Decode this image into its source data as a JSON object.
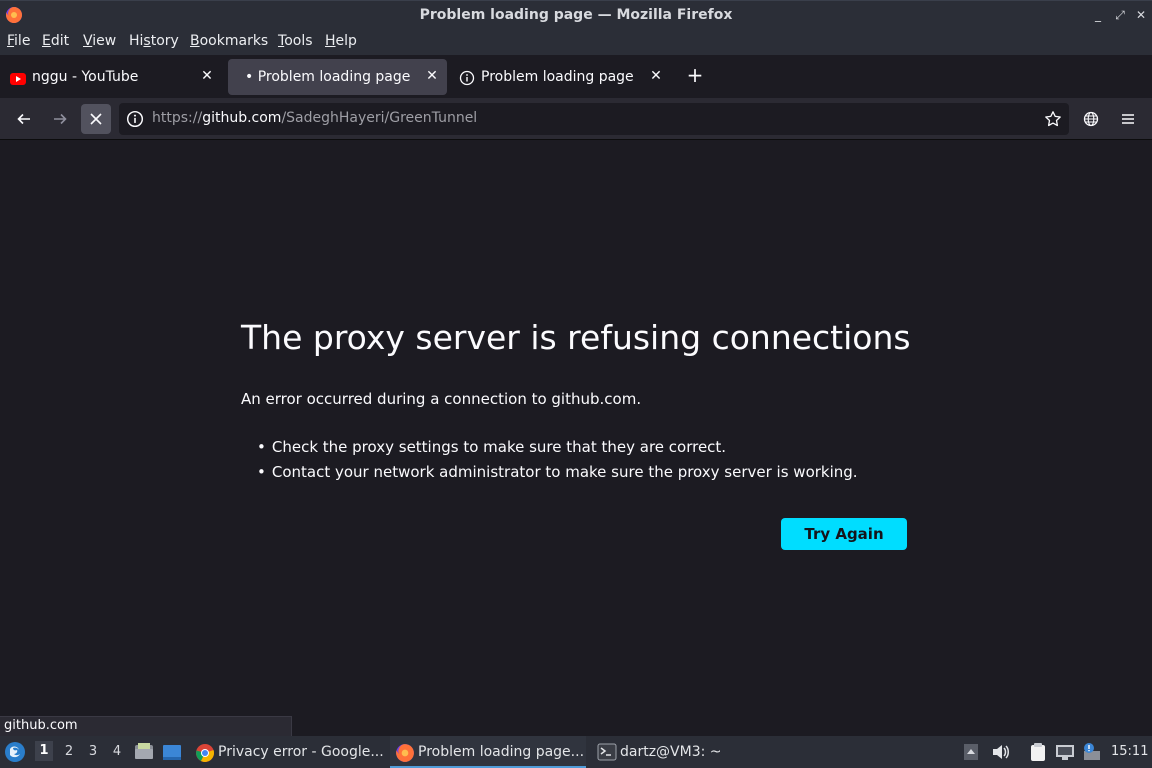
{
  "window": {
    "title": "Problem loading page — Mozilla Firefox",
    "controls": [
      "minimize-icon",
      "maximize-icon",
      "close-icon"
    ]
  },
  "menubar": {
    "items": [
      {
        "label": "File",
        "mnemonic": "F",
        "rest": "ile"
      },
      {
        "label": "Edit",
        "mnemonic": "E",
        "rest": "dit"
      },
      {
        "label": "View",
        "mnemonic": "V",
        "rest": "iew"
      },
      {
        "label": "History",
        "pre": "Hi",
        "mnemonic": "s",
        "rest": "tory"
      },
      {
        "label": "Bookmarks",
        "mnemonic": "B",
        "rest": "ookmarks"
      },
      {
        "label": "Tools",
        "mnemonic": "T",
        "rest": "ools"
      },
      {
        "label": "Help",
        "mnemonic": "H",
        "rest": "elp"
      }
    ]
  },
  "tabs": [
    {
      "label": "nggu - YouTube",
      "icon": "youtube-icon",
      "active": false
    },
    {
      "label": "• Problem loading page",
      "icon": "",
      "active": true
    },
    {
      "label": "Problem loading page",
      "icon": "info-icon",
      "active": false
    }
  ],
  "navbar": {
    "url_prefix": "https://",
    "url_host": "github.com",
    "url_path": "/SadeghHayeri/GreenTunnel"
  },
  "error": {
    "title": "The proxy server is refusing connections",
    "description": "An error occurred during a connection to github.com.",
    "bullets": [
      "Check the proxy settings to make sure that they are correct.",
      "Contact your network administrator to make sure the proxy server is working."
    ],
    "button": "Try Again"
  },
  "status": {
    "text": "github.com"
  },
  "taskbar": {
    "workspaces": [
      "1",
      "2",
      "3",
      "4"
    ],
    "current_workspace": "1",
    "tasks": [
      {
        "label": "Privacy error - Google...",
        "icon": "chrome-icon",
        "active": false
      },
      {
        "label": "Problem loading page...",
        "icon": "firefox-icon",
        "active": true
      },
      {
        "label": "dartz@VM3: ~",
        "icon": "terminal-icon",
        "active": false
      }
    ],
    "clock": "15:11"
  },
  "colors": {
    "accent_button": "#00ddff",
    "page_bg": "#1c1b22",
    "chrome_bg": "#2b2e37"
  }
}
